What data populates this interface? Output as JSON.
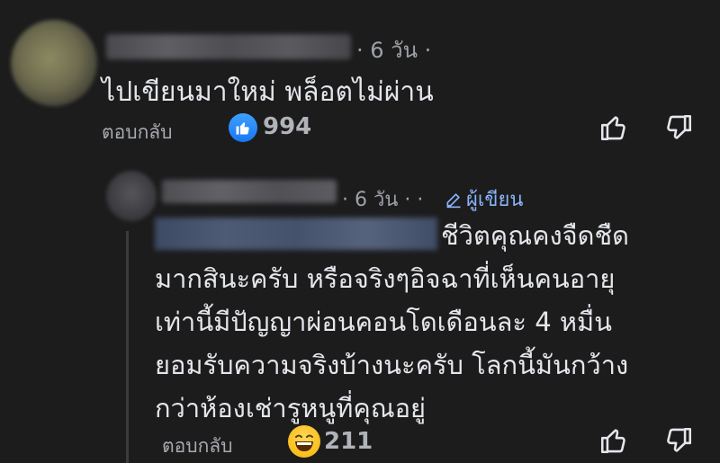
{
  "comment": {
    "time": "· 6 วัน ·",
    "text": "ไปเขียนมาใหม่ พล็อตไม่ผ่าน",
    "reply_label": "ตอบกลับ",
    "reaction_count": "994",
    "reaction_icon": "like-icon"
  },
  "reply": {
    "time": "· 6 วัน · ·",
    "author_badge": "ผู้เขียน",
    "text_lines": [
      "ชีวิตคุณคงจืดชืด",
      "มากสินะครับ หรือจริงๆอิจฉาที่เห็นคนอายุ",
      "เท่านี้มีปัญญาผ่อนคอนโดเดือนละ 4 หมื่น",
      "ยอมรับความจริงบ้างนะครับ โลกนี้มันกว้าง",
      "กว่าห้องเช่ารูหนูที่คุณอยู่"
    ],
    "reply_label": "ตอบกลับ",
    "reaction_count": "211",
    "reaction_icon": "laughing-emoji-icon"
  },
  "colors": {
    "background": "#1c1c1d",
    "text": "#e4e6eb",
    "secondary": "#b0b3b8",
    "accent": "#1877f2"
  }
}
